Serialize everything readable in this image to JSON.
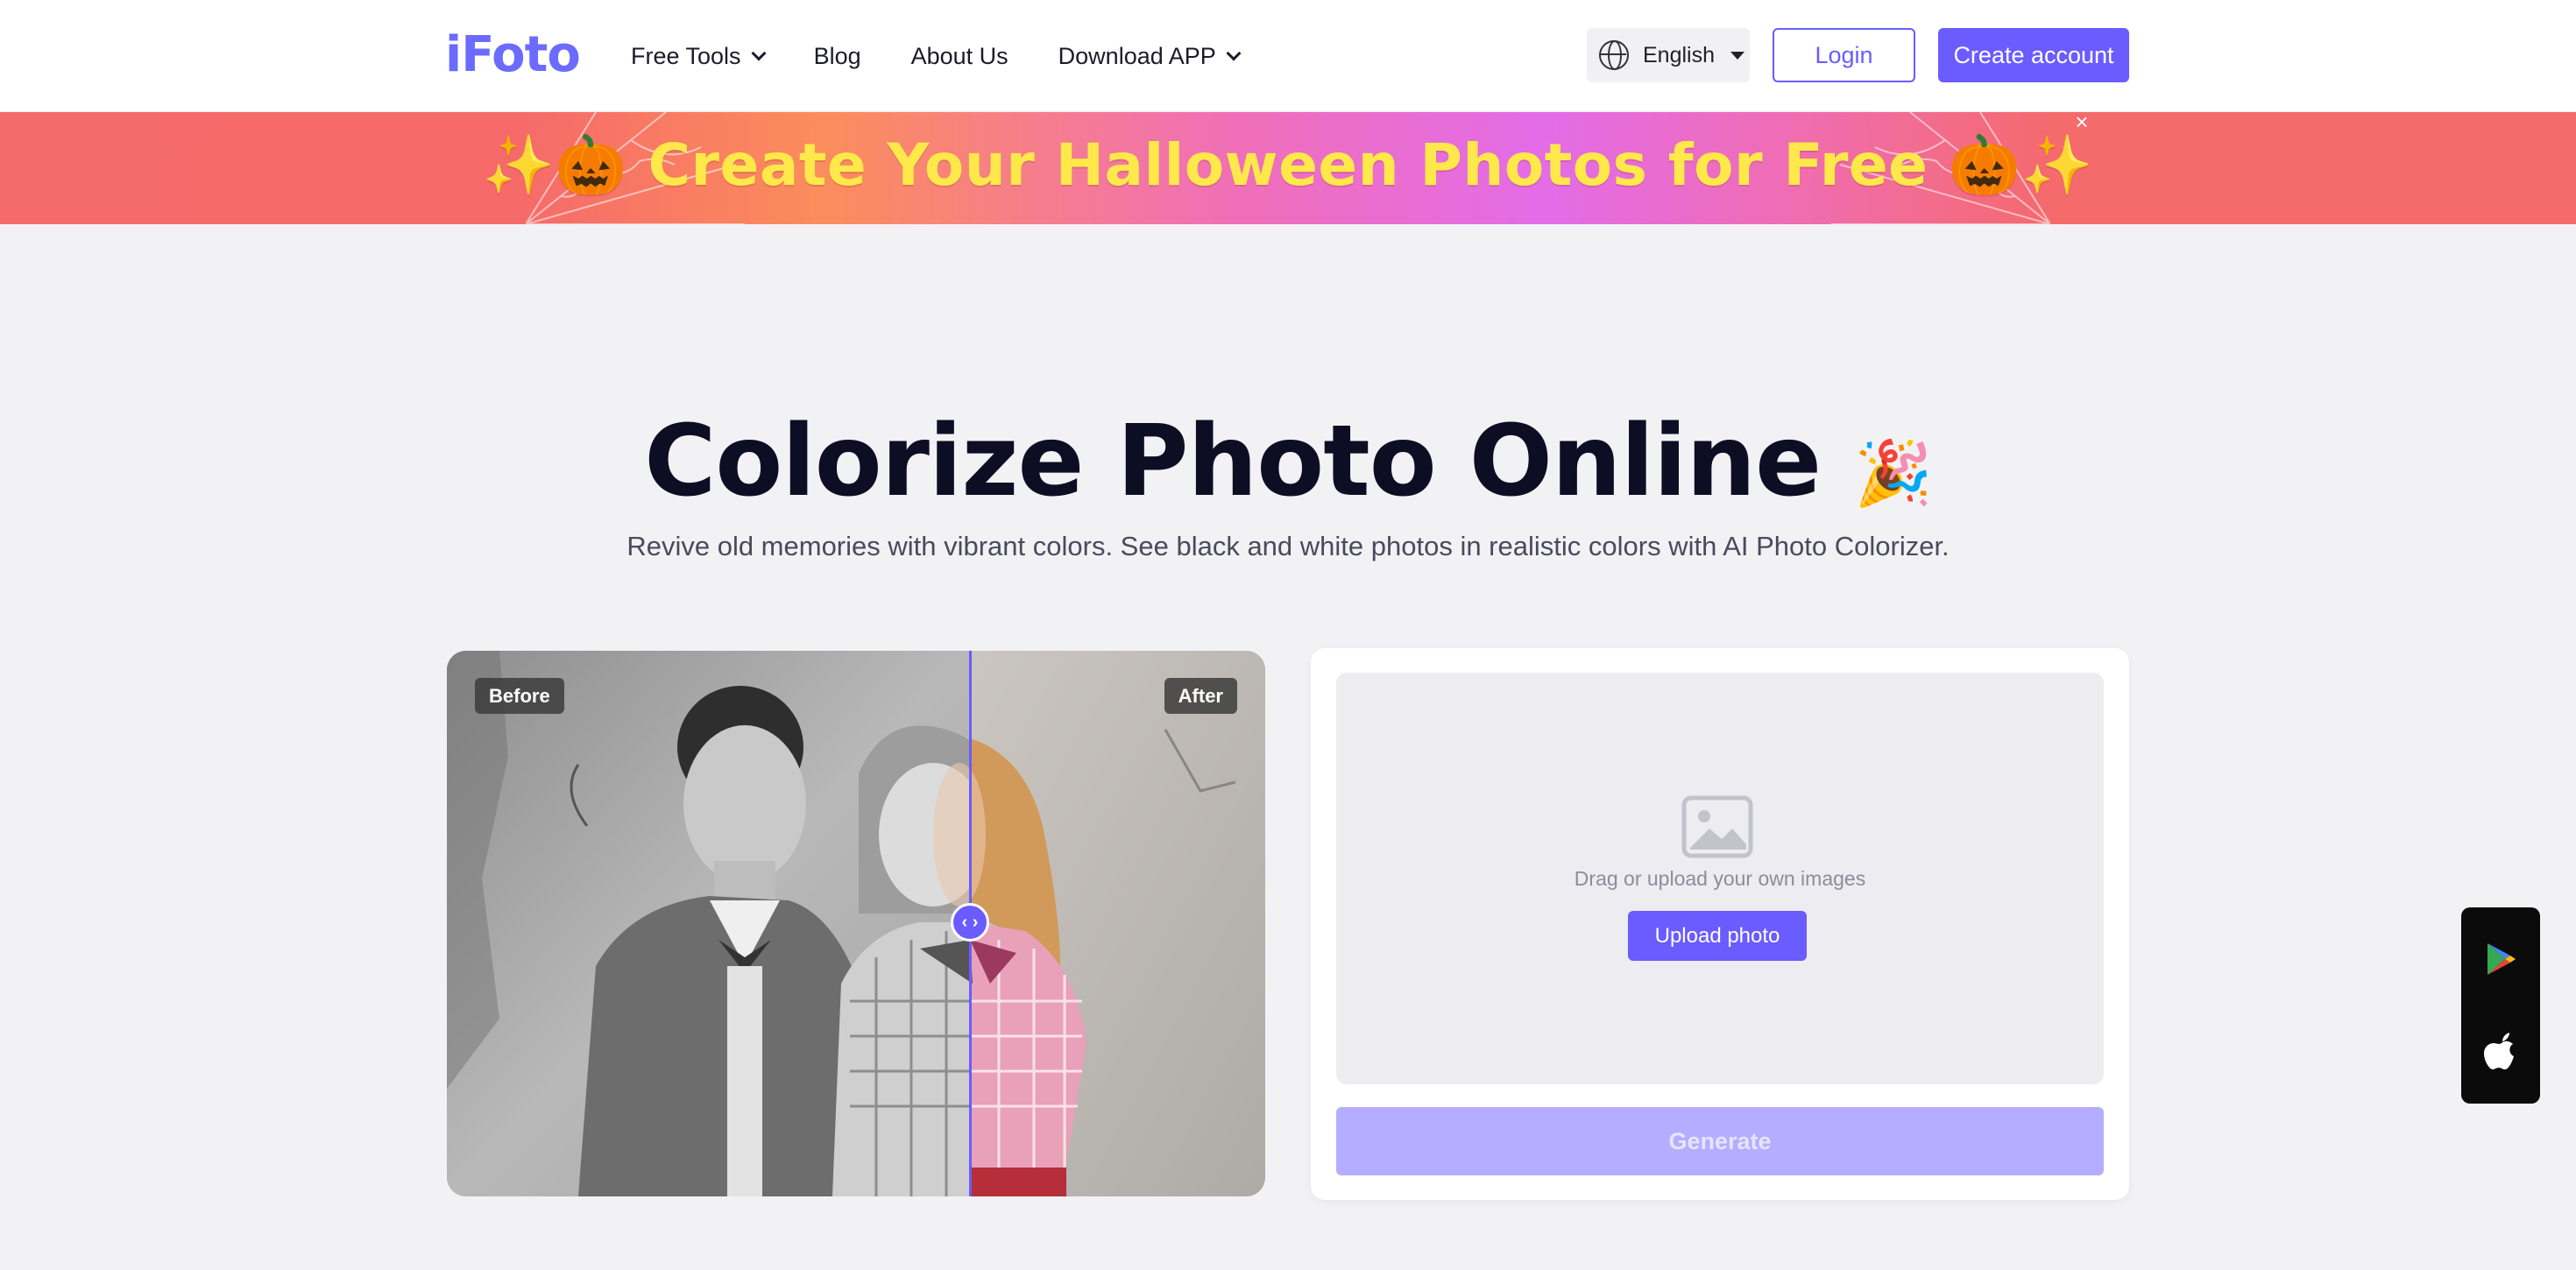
{
  "header": {
    "logo": "iFoto",
    "nav": [
      {
        "label": "Free Tools",
        "has_dropdown": true
      },
      {
        "label": "Blog",
        "has_dropdown": false
      },
      {
        "label": "About Us",
        "has_dropdown": false
      },
      {
        "label": "Download APP",
        "has_dropdown": true
      }
    ],
    "language": "English",
    "login_label": "Login",
    "create_account_label": "Create account",
    "accent_color": "#6a5cff"
  },
  "banner": {
    "text": "✨🎃 Create Your Halloween Photos for Free 🎃✨",
    "close_icon": "close-icon"
  },
  "hero": {
    "title": "Colorize Photo Online",
    "title_emoji": "🎉",
    "subtitle": "Revive old memories with vibrant colors. See black and white photos in realistic colors with AI Photo Colorizer."
  },
  "compare": {
    "before_label": "Before",
    "after_label": "After",
    "handle_glyph": "‹ ›"
  },
  "upload": {
    "drop_text": "Drag or upload your own images",
    "upload_label": "Upload photo",
    "generate_label": "Generate"
  },
  "app_download": {
    "icons": [
      "google-play-icon",
      "apple-icon"
    ]
  }
}
